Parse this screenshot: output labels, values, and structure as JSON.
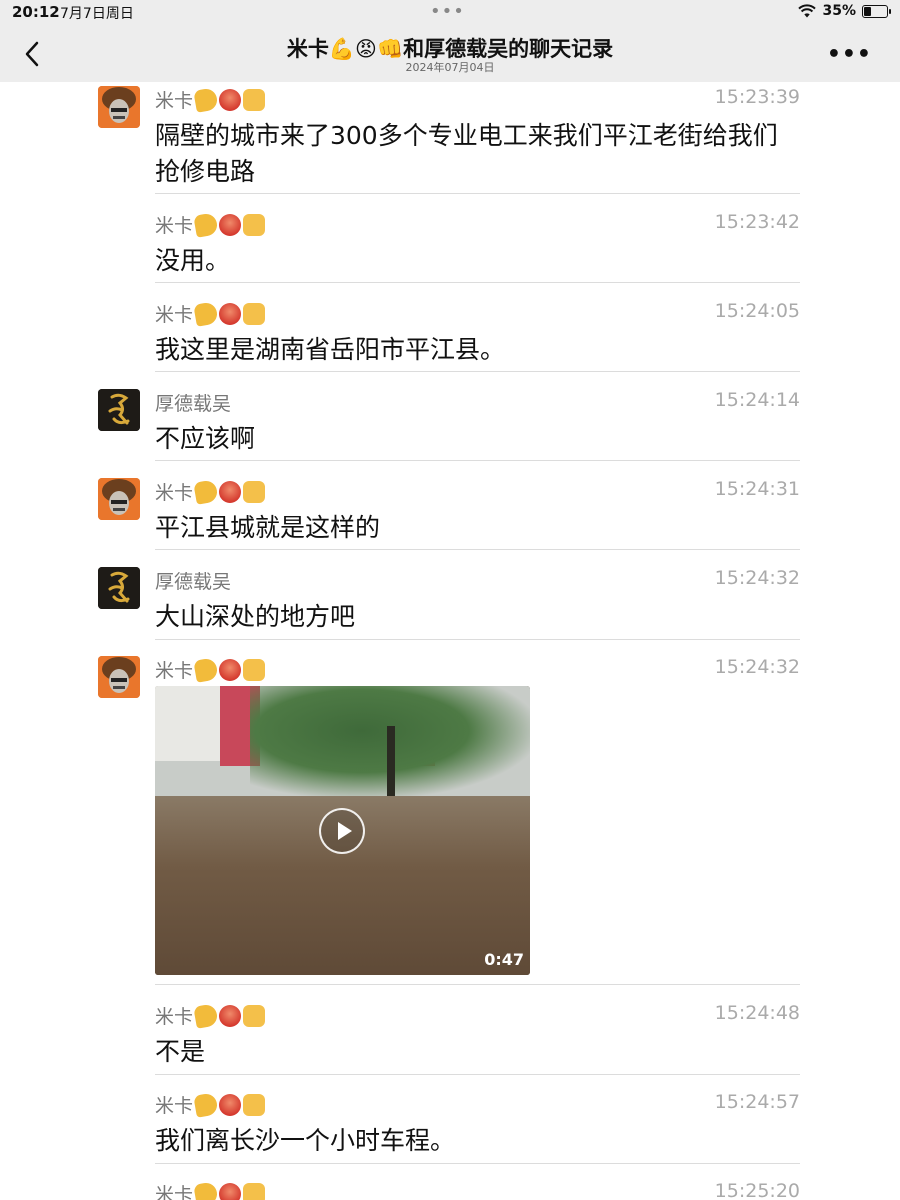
{
  "status_bar": {
    "time": "20:12",
    "date": "7月7日周日",
    "battery": "35%",
    "battery_level": 0.35
  },
  "header": {
    "title": "米卡💪😡👊和厚德载吴的聊天记录",
    "subtitle": "2024年07月04日"
  },
  "messages": [
    {
      "sender": "米卡",
      "time": "15:23:39",
      "text": "隔壁的城市来了300多个专业电工来我们平江老街给我们抢修电路"
    },
    {
      "sender": "米卡",
      "time": "15:23:42",
      "text": "没用。"
    },
    {
      "sender": "米卡",
      "time": "15:24:05",
      "text": "我这里是湖南省岳阳市平江县。"
    },
    {
      "sender": "厚德载吴",
      "time": "15:24:14",
      "text": "不应该啊"
    },
    {
      "sender": "米卡",
      "time": "15:24:31",
      "text": "平江县城就是这样的"
    },
    {
      "sender": "厚德载吴",
      "time": "15:24:32",
      "text": "大山深处的地方吧"
    },
    {
      "sender": "米卡",
      "time": "15:24:32",
      "video_duration": "0:47"
    },
    {
      "sender": "米卡",
      "time": "15:24:48",
      "text": "不是"
    },
    {
      "sender": "米卡",
      "time": "15:24:57",
      "text": "我们离长沙一个小时车程。"
    },
    {
      "sender": "米卡",
      "time": "15:25:20"
    }
  ],
  "icons": {
    "back": "chevron-left-icon",
    "more": "more-icon",
    "wifi": "wifi-icon",
    "battery": "battery-icon",
    "play": "play-icon"
  },
  "colors": {
    "nav_background": "#ededed",
    "timestamp": "#aaaaaa",
    "sender": "#777777"
  }
}
